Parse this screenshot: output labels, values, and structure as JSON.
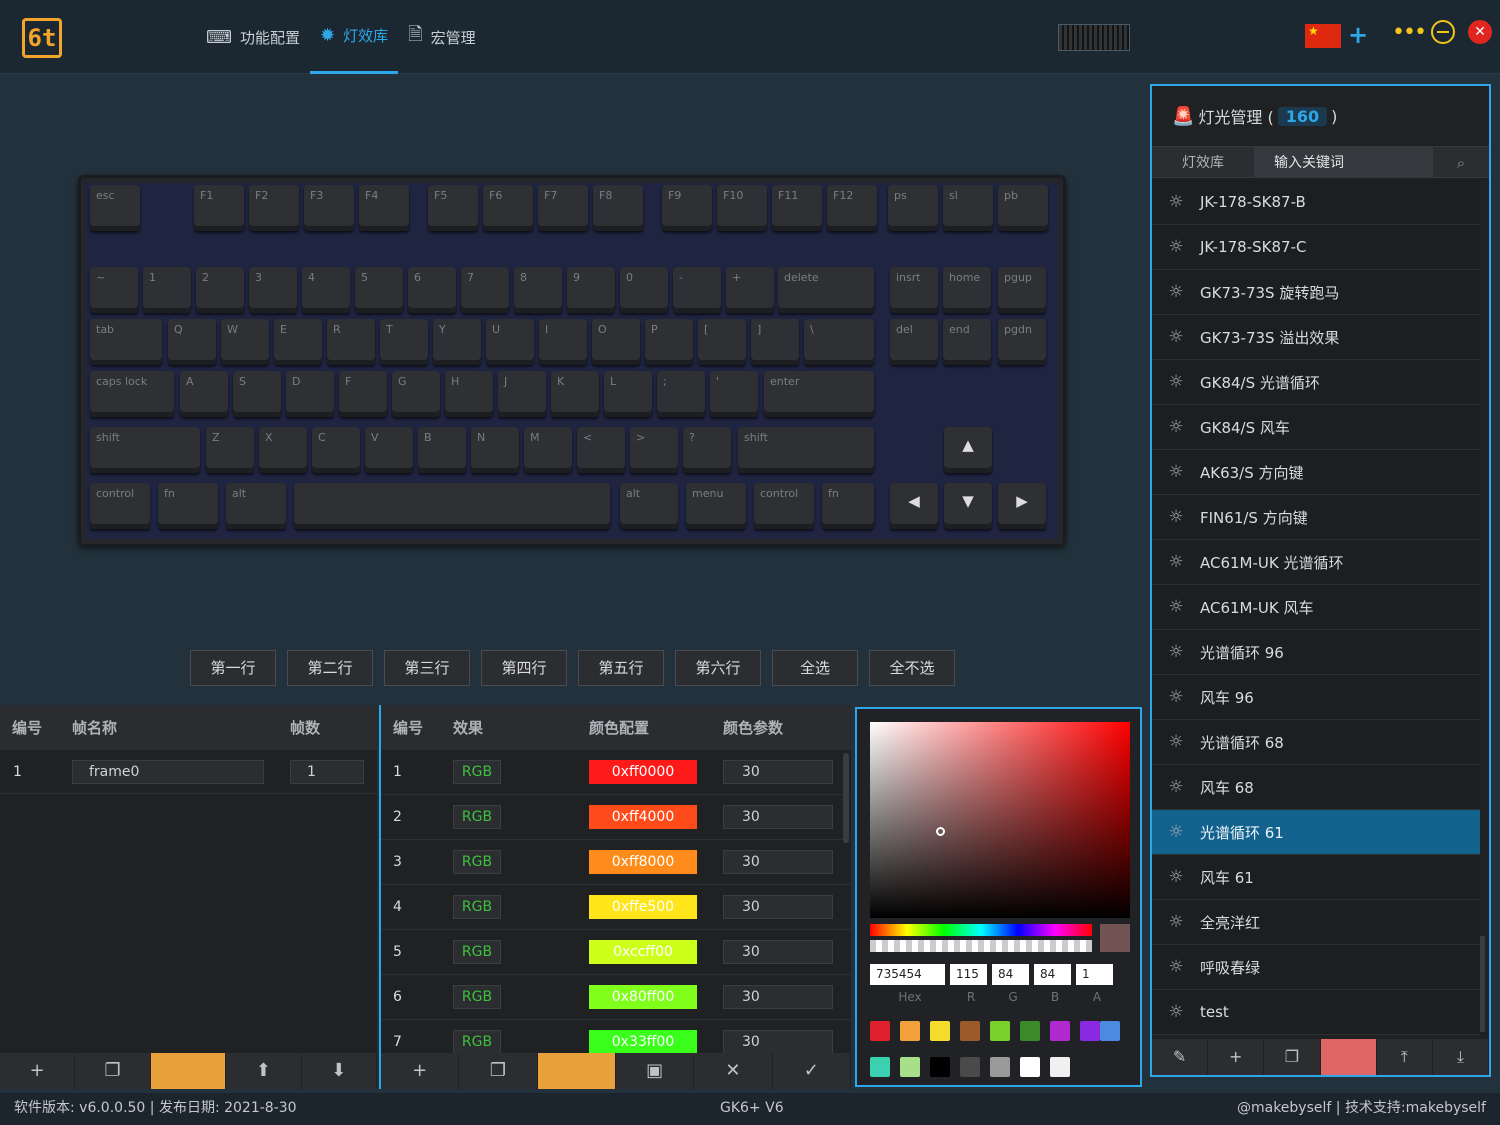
{
  "header": {
    "logo_text": "6t",
    "tabs": [
      {
        "label": "功能配置",
        "icon": "keyboard-icon"
      },
      {
        "label": "灯效库",
        "icon": "gear-icon"
      },
      {
        "label": "宏管理",
        "icon": "document-icon"
      }
    ],
    "active_tab": 1,
    "plus_label": "+",
    "menu_label": "•••",
    "close_label": "✕"
  },
  "keyboard": {
    "row1": [
      "esc",
      "F1",
      "F2",
      "F3",
      "F4",
      "F5",
      "F6",
      "F7",
      "F8",
      "F9",
      "F10",
      "F11",
      "F12",
      "ps",
      "sl",
      "pb"
    ],
    "row2": [
      "~",
      "1",
      "2",
      "3",
      "4",
      "5",
      "6",
      "7",
      "8",
      "9",
      "0",
      "-",
      "+",
      "delete",
      "insrt",
      "home",
      "pgup"
    ],
    "row3": [
      "tab",
      "Q",
      "W",
      "E",
      "R",
      "T",
      "Y",
      "U",
      "I",
      "O",
      "P",
      "[",
      "]",
      "\\",
      "del",
      "end",
      "pgdn"
    ],
    "row4": [
      "caps lock",
      "A",
      "S",
      "D",
      "F",
      "G",
      "H",
      "J",
      "K",
      "L",
      ";",
      "'",
      "enter"
    ],
    "row5": [
      "shift",
      "Z",
      "X",
      "C",
      "V",
      "B",
      "N",
      "M",
      "<",
      ">",
      "?",
      "shift",
      "▲"
    ],
    "row6": [
      "control",
      "fn",
      "alt",
      "",
      "alt",
      "menu",
      "control",
      "fn",
      "◀",
      "▼",
      "▶"
    ]
  },
  "row_buttons": [
    "第一行",
    "第二行",
    "第三行",
    "第四行",
    "第五行",
    "第六行",
    "全选",
    "全不选"
  ],
  "frames": {
    "headers": {
      "id": "编号",
      "name": "帧名称",
      "count": "帧数"
    },
    "rows": [
      {
        "id": "1",
        "name": "frame0",
        "count": "1"
      }
    ],
    "toolbar": [
      "+",
      "❐",
      "",
      "⬆",
      "⬇"
    ]
  },
  "effects": {
    "headers": {
      "id": "编号",
      "effect": "效果",
      "color": "颜色配置",
      "param": "颜色参数"
    },
    "rows": [
      {
        "id": "1",
        "effect": "RGB",
        "color": "0xff0000",
        "hex": "#ff1a1a",
        "param": "30"
      },
      {
        "id": "2",
        "effect": "RGB",
        "color": "0xff4000",
        "hex": "#ff4a1a",
        "param": "30"
      },
      {
        "id": "3",
        "effect": "RGB",
        "color": "0xff8000",
        "hex": "#ff8c1a",
        "param": "30"
      },
      {
        "id": "4",
        "effect": "RGB",
        "color": "0xffe500",
        "hex": "#ffe51a",
        "param": "30"
      },
      {
        "id": "5",
        "effect": "RGB",
        "color": "0xccff00",
        "hex": "#ccff1a",
        "param": "30"
      },
      {
        "id": "6",
        "effect": "RGB",
        "color": "0x80ff00",
        "hex": "#80ff1a",
        "param": "30"
      },
      {
        "id": "7",
        "effect": "RGB",
        "color": "0x33ff00",
        "hex": "#3aff1a",
        "param": "30"
      }
    ],
    "toolbar": [
      "+",
      "❐",
      "",
      "▣",
      "✕",
      "✓"
    ]
  },
  "picker": {
    "hex": "735454",
    "r": "115",
    "g": "84",
    "b": "84",
    "a": "1",
    "labels": [
      "Hex",
      "R",
      "G",
      "B",
      "A"
    ],
    "swatches": [
      "#e0202a",
      "#f2a03a",
      "#f5dc2a",
      "#9a5a2a",
      "#7ad02a",
      "#3a8a2a",
      "#b02ad0",
      "#8a2ae0",
      "#4a8ae0",
      "#3ad0b0",
      "#a8e08a",
      "#000000",
      "#4a4a4a",
      "#9a9a9a",
      "#ffffff",
      "#f0f0f0"
    ]
  },
  "lights": {
    "title": "灯光管理 (",
    "count": "160",
    "title_end": ")",
    "search_label": "灯效库",
    "search_value": "输入关键词",
    "items": [
      "JK-178-SK87-B",
      "JK-178-SK87-C",
      "GK73-73S 旋转跑马",
      "GK73-73S 溢出效果",
      "GK84/S 光谱循环",
      "GK84/S 风车",
      "AK63/S 方向键",
      "FIN61/S 方向键",
      "AC61M-UK 光谱循环",
      "AC61M-UK 风车",
      "光谱循环 96",
      "风车 96",
      "光谱循环 68",
      "风车 68",
      "光谱循环 61",
      "风车 61",
      "全亮洋红",
      "呼吸春绿",
      "test"
    ],
    "selected": 14,
    "toolbar": [
      "✎",
      "+",
      "❐",
      "",
      "⤒",
      "⤓"
    ]
  },
  "status": {
    "left": "软件版本: v6.0.0.50 | 发布日期: 2021-8-30",
    "center": "GK6+ V6",
    "right": "@makebyself | 技术支持:makebyself"
  }
}
